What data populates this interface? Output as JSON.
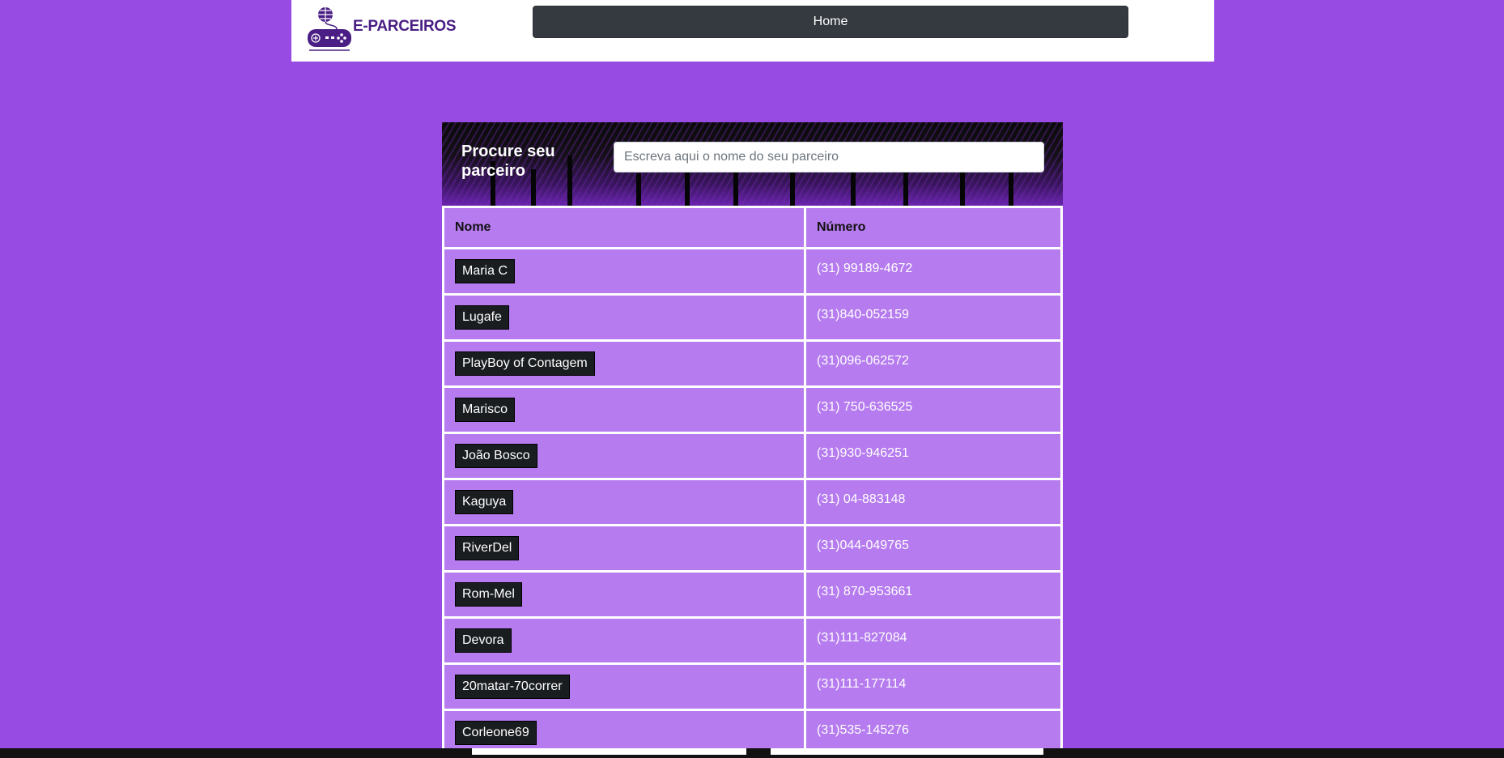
{
  "brand": {
    "name": "E-PARCEIROS",
    "logo_icon": "gamepad-globe-icon"
  },
  "nav": {
    "home_label": "Home"
  },
  "search": {
    "title": "Procure seu parceiro",
    "placeholder": "Escreva aqui o nome do seu parceiro"
  },
  "table": {
    "headers": {
      "name": "Nome",
      "number": "Número"
    },
    "rows": [
      {
        "name": "Maria C",
        "number": "(31) 99189-4672"
      },
      {
        "name": "Lugafe",
        "number": "(31)840-052159"
      },
      {
        "name": "PlayBoy of Contagem",
        "number": "(31)096-062572"
      },
      {
        "name": "Marisco",
        "number": "(31) 750-636525"
      },
      {
        "name": "João Bosco",
        "number": "(31)930-946251"
      },
      {
        "name": "Kaguya",
        "number": "(31) 04-883148"
      },
      {
        "name": "RiverDel",
        "number": "(31)044-049765"
      },
      {
        "name": "Rom-Mel",
        "number": "(31) 870-953661"
      },
      {
        "name": "Devora",
        "number": "(31)111-827084"
      },
      {
        "name": "20matar-70correr",
        "number": "(31)111-177114"
      },
      {
        "name": "Corleone69",
        "number": "(31)535-145276"
      }
    ]
  },
  "colors": {
    "background": "#974be2",
    "table_bg": "#b57bef",
    "button_dark": "#343a40",
    "brand_text": "#4a1e84"
  }
}
